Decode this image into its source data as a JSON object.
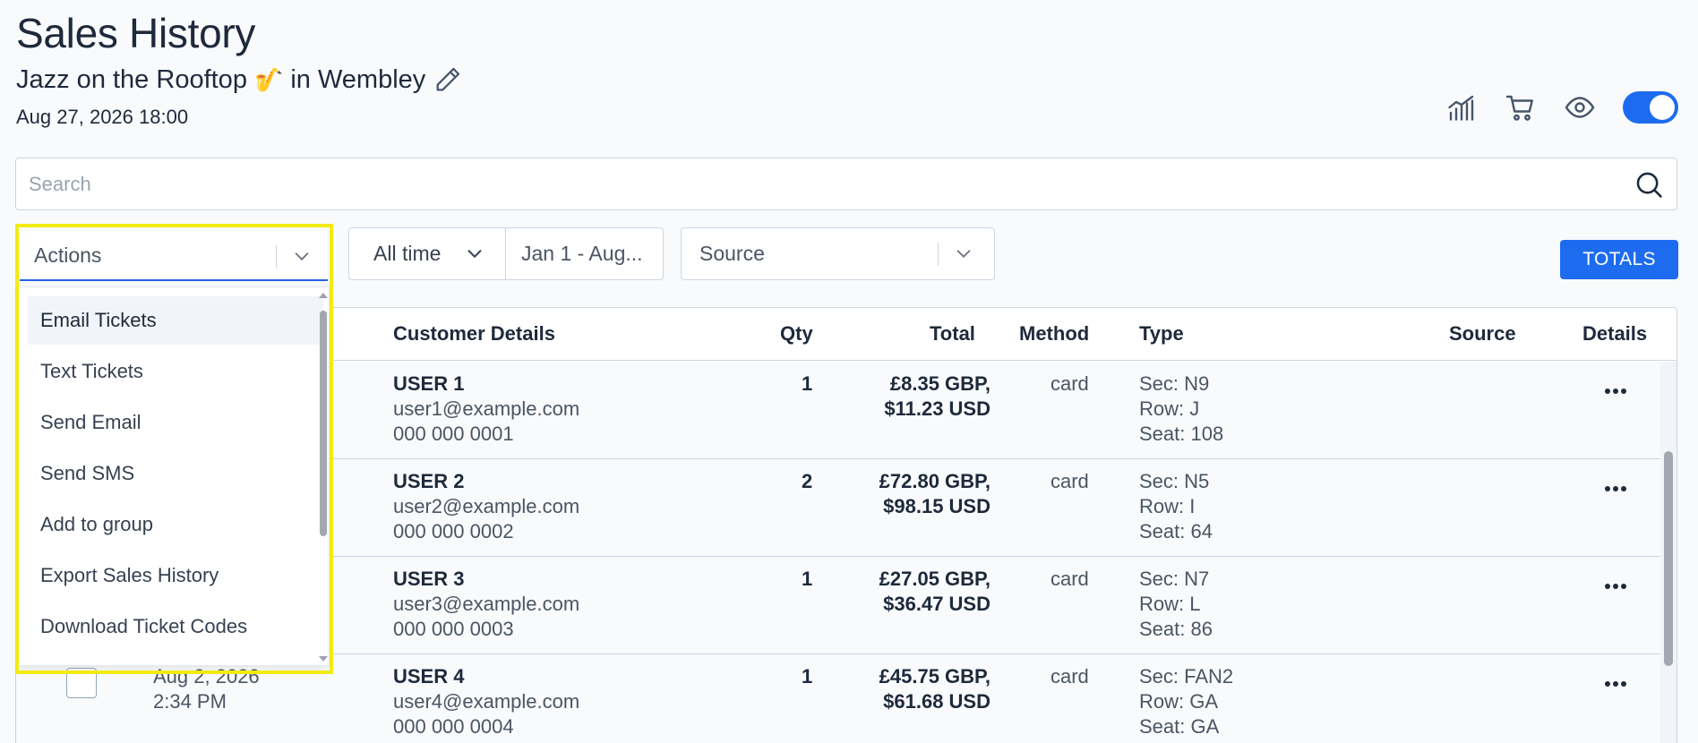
{
  "header": {
    "title": "Sales History",
    "event_name": "Jazz on the Rooftop",
    "event_emoji": "🎷",
    "event_location": "in Wembley",
    "event_datetime": "Aug 27, 2026 18:00"
  },
  "toolbar_icons": [
    "chart-icon",
    "cart-icon",
    "eye-icon",
    "toggle-switch"
  ],
  "search": {
    "placeholder": "Search"
  },
  "filters": {
    "actions_label": "Actions",
    "time_range": "All time",
    "date_range": "Jan 1 - Aug...",
    "source_label": "Source",
    "totals_label": "TOTALS"
  },
  "actions_menu": [
    "Email Tickets",
    "Text Tickets",
    "Send Email",
    "Send SMS",
    "Add to group",
    "Export Sales History",
    "Download Ticket Codes"
  ],
  "table": {
    "headers": {
      "customer": "Customer Details",
      "qty": "Qty",
      "total": "Total",
      "method": "Method",
      "type": "Type",
      "source": "Source",
      "details": "Details"
    },
    "rows": [
      {
        "date": "",
        "time": "",
        "name": "USER 1",
        "email": "user1@example.com",
        "phone": "000 000 0001",
        "qty": "1",
        "total_gbp": "£8.35 GBP,",
        "total_usd": "$11.23 USD",
        "method": "card",
        "sec": "Sec: N9",
        "row": "Row: J",
        "seat": "Seat: 108"
      },
      {
        "date": "",
        "time": "",
        "name": "USER 2",
        "email": "user2@example.com",
        "phone": "000 000 0002",
        "qty": "2",
        "total_gbp": "£72.80 GBP,",
        "total_usd": "$98.15 USD",
        "method": "card",
        "sec": "Sec: N5",
        "row": "Row: I",
        "seat": "Seat: 64"
      },
      {
        "date": "",
        "time": "",
        "name": "USER 3",
        "email": "user3@example.com",
        "phone": "000 000 0003",
        "qty": "1",
        "total_gbp": "£27.05 GBP,",
        "total_usd": "$36.47 USD",
        "method": "card",
        "sec": "Sec: N7",
        "row": "Row: L",
        "seat": "Seat: 86"
      },
      {
        "date": "Aug 2, 2026",
        "time": "2:34 PM",
        "name": "USER 4",
        "email": "user4@example.com",
        "phone": "000 000 0004",
        "qty": "1",
        "total_gbp": "£45.75 GBP,",
        "total_usd": "$61.68 USD",
        "method": "card",
        "sec": "Sec: FAN2",
        "row": "Row: GA",
        "seat": "Seat: GA"
      }
    ]
  },
  "colors": {
    "accent": "#1d6cf0",
    "highlight": "#f2eb13"
  }
}
